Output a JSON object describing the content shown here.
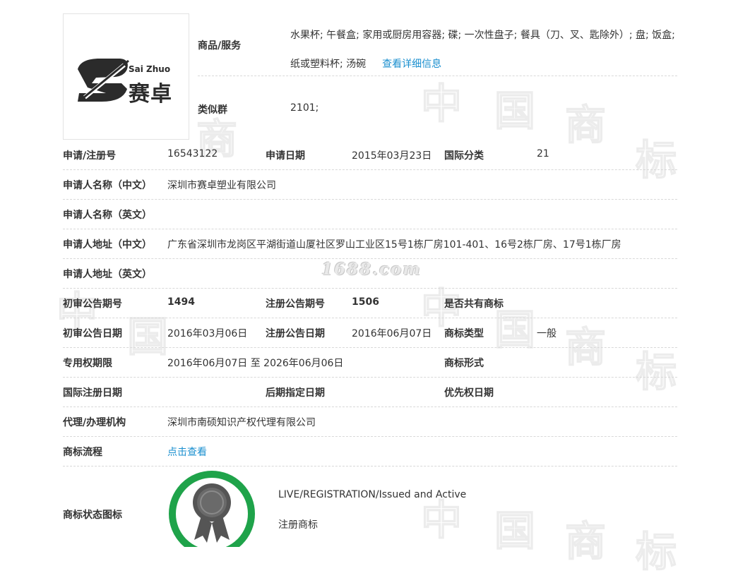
{
  "logo": {
    "brand_en": "Sai Zhuo",
    "brand_cn": "赛卓"
  },
  "top": {
    "goods_label": "商品/服务",
    "goods_text": "水果杯; 午餐盒; 家用或厨房用容器; 碟; 一次性盘子; 餐具（刀、叉、匙除外）; 盘; 饭盒; 纸或塑料杯; 汤碗",
    "goods_link": "查看详细信息",
    "similar_label": "类似群",
    "similar_value": "2101;"
  },
  "rows": {
    "reg_no_label": "申请/注册号",
    "reg_no": "16543122",
    "apply_date_label": "申请日期",
    "apply_date": "2015年03月23日",
    "intl_class_label": "国际分类",
    "intl_class": "21",
    "applicant_cn_label": "申请人名称（中文）",
    "applicant_cn": "深圳市赛卓塑业有限公司",
    "applicant_en_label": "申请人名称（英文）",
    "address_cn_label": "申请人地址（中文）",
    "address_cn": "广东省深圳市龙岗区平湖街道山厦社区罗山工业区15号1栋厂房101-401、16号2栋厂房、17号1栋厂房",
    "address_en_label": "申请人地址（英文）",
    "prelim_no_label": "初审公告期号",
    "prelim_no": "1494",
    "reg_pub_no_label": "注册公告期号",
    "reg_pub_no": "1506",
    "shared_label": "是否共有商标",
    "prelim_date_label": "初审公告日期",
    "prelim_date": "2016年03月06日",
    "reg_pub_date_label": "注册公告日期",
    "reg_pub_date": "2016年06月07日",
    "tm_type_label": "商标类型",
    "tm_type": "一般",
    "term_label": "专用权期限",
    "term": "2016年06月07日 至 2026年06月06日",
    "tm_form_label": "商标形式",
    "intl_reg_date_label": "国际注册日期",
    "later_date_label": "后期指定日期",
    "priority_label": "优先权日期",
    "agent_label": "代理/办理机构",
    "agent": "深圳市南硕知识产权代理有限公司",
    "process_label": "商标流程",
    "process_link": "点击查看",
    "status_icon_label": "商标状态图标",
    "status_en": "LIVE/REGISTRATION/Issued and Active",
    "status_cn": "注册商标"
  },
  "watermark": {
    "site": "1688.com",
    "glyphs": [
      "中",
      "国",
      "商",
      "标"
    ]
  },
  "colors": {
    "link": "#1a8fcf",
    "badge_ring": "#1fa34a",
    "badge_icon": "#555555"
  }
}
